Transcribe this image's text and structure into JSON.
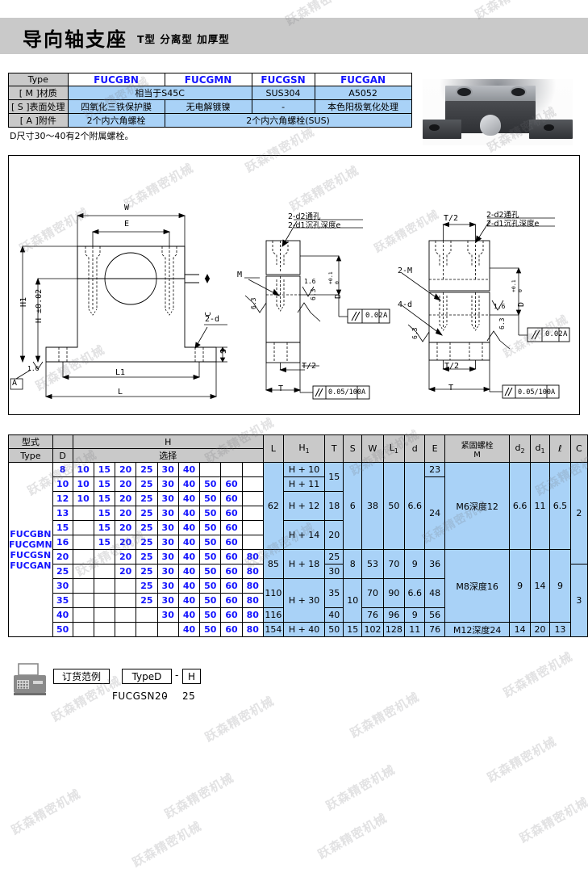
{
  "header": {
    "title": "导向轴支座",
    "subtitle": "T型  分离型  加厚型"
  },
  "spec_table": {
    "rows": [
      {
        "label": "Type",
        "cells": [
          {
            "t": "FUCGBN",
            "span": 1,
            "style": "type"
          },
          {
            "t": "FUCGMN",
            "span": 1,
            "style": "type"
          },
          {
            "t": "FUCGSN",
            "span": 1,
            "style": "type"
          },
          {
            "t": "FUCGAN",
            "span": 1,
            "style": "type"
          }
        ]
      },
      {
        "label": "[ M ]材质",
        "cells": [
          {
            "t": "相当于S45C",
            "span": 2,
            "style": "cell"
          },
          {
            "t": "SUS304",
            "span": 1,
            "style": "cell"
          },
          {
            "t": "A5052",
            "span": 1,
            "style": "cell"
          }
        ]
      },
      {
        "label": "[ S ]表面处理",
        "cells": [
          {
            "t": "四氧化三铁保护膜",
            "span": 1,
            "style": "cell"
          },
          {
            "t": "无电解镀镍",
            "span": 1,
            "style": "cell"
          },
          {
            "t": "-",
            "span": 1,
            "style": "cell"
          },
          {
            "t": "本色阳极氧化处理",
            "span": 1,
            "style": "cell"
          }
        ]
      },
      {
        "label": "[ A ]附件",
        "cells": [
          {
            "t": "2个内六角螺栓",
            "span": 1,
            "style": "cell"
          },
          {
            "t": "2个内六角螺栓(SUS)",
            "span": 3,
            "style": "cell"
          }
        ]
      }
    ],
    "note": "D尺寸30～40有2个附属螺栓。"
  },
  "drawings": {
    "front": {
      "labels": [
        "W",
        "E",
        "H1",
        "H ±0.02",
        "C",
        "2-d",
        "S",
        "L1",
        "L",
        "1.6",
        "A"
      ]
    },
    "side_small": {
      "labels": [
        "2-d2通孔",
        "2-d1沉孔深度e",
        "M",
        "1.6",
        "6.3",
        "T/2",
        "T",
        "// 0.02 A",
        "// 0.05/100 A"
      ]
    },
    "side_large": {
      "labels": [
        "2-d2通孔",
        "2-d1沉孔深度e",
        "2-M",
        "4-d",
        "1.6",
        "6.3",
        "T/2",
        "T",
        "// 0.02 A",
        "// 0.05/100 A"
      ]
    },
    "tolerance_02": "0.02",
    "tolerance_05": "0.05/100",
    "datum": "A",
    "dia_label": "D",
    "dia_tol_upper": "+0.1",
    "dia_tol_lower": "0"
  },
  "dim_table": {
    "headers": {
      "type_cn": "型式",
      "type_en": "Type",
      "d": "D",
      "h": "H",
      "h_sel": "选择",
      "l": "L",
      "h1": "H",
      "h1_sub": "1",
      "t": "T",
      "s": "S",
      "w": "W",
      "l1": "L",
      "l1_sub": "1",
      "d_small": "d",
      "e": "E",
      "bolt_cn": "紧固螺栓",
      "bolt_m": "M",
      "d2": "d",
      "d2_sub": "2",
      "d1": "d",
      "d1_sub": "1",
      "l_len": "ℓ",
      "c": "C"
    },
    "types": [
      "FUCGBN",
      "FUCGMN",
      "FUCGSN",
      "FUCGAN"
    ],
    "h_columns": [
      "10",
      "15",
      "20",
      "25",
      "30",
      "40",
      "50",
      "60",
      "80"
    ],
    "rows": [
      {
        "d": "8",
        "h_sel": [
          "10",
          "15",
          "20",
          "25",
          "30",
          "40",
          "",
          "",
          ""
        ]
      },
      {
        "d": "10",
        "h_sel": [
          "10",
          "15",
          "20",
          "25",
          "30",
          "40",
          "50",
          "60",
          ""
        ]
      },
      {
        "d": "12",
        "h_sel": [
          "10",
          "15",
          "20",
          "25",
          "30",
          "40",
          "50",
          "60",
          ""
        ]
      },
      {
        "d": "13",
        "h_sel": [
          "",
          "15",
          "20",
          "25",
          "30",
          "40",
          "50",
          "60",
          ""
        ]
      },
      {
        "d": "15",
        "h_sel": [
          "",
          "15",
          "20",
          "25",
          "30",
          "40",
          "50",
          "60",
          ""
        ]
      },
      {
        "d": "16",
        "h_sel": [
          "",
          "15",
          "20",
          "25",
          "30",
          "40",
          "50",
          "60",
          ""
        ]
      },
      {
        "d": "20",
        "h_sel": [
          "",
          "",
          "20",
          "25",
          "30",
          "40",
          "50",
          "60",
          "80"
        ]
      },
      {
        "d": "25",
        "h_sel": [
          "",
          "",
          "20",
          "25",
          "30",
          "40",
          "50",
          "60",
          "80"
        ]
      },
      {
        "d": "30",
        "h_sel": [
          "",
          "",
          "",
          "25",
          "30",
          "40",
          "50",
          "60",
          "80"
        ]
      },
      {
        "d": "35",
        "h_sel": [
          "",
          "",
          "",
          "25",
          "30",
          "40",
          "50",
          "60",
          "80"
        ]
      },
      {
        "d": "40",
        "h_sel": [
          "",
          "",
          "",
          "",
          "30",
          "40",
          "50",
          "60",
          "80"
        ]
      },
      {
        "d": "50",
        "h_sel": [
          "",
          "",
          "",
          "",
          "",
          "40",
          "50",
          "60",
          "80"
        ]
      }
    ],
    "L": [
      {
        "v": "62",
        "span": 6
      },
      {
        "v": "85",
        "span": 2
      },
      {
        "v": "110",
        "span": 2
      },
      {
        "v": "116",
        "span": 1
      },
      {
        "v": "154",
        "span": 1
      }
    ],
    "H1": [
      {
        "v": "H + 10",
        "span": 1
      },
      {
        "v": "H + 11",
        "span": 1
      },
      {
        "v": "H + 12",
        "span": 2
      },
      {
        "v": "H + 14",
        "span": 2
      },
      {
        "v": "H + 18",
        "span": 2
      },
      {
        "v": "H + 30",
        "span": 3
      },
      {
        "v": "H + 40",
        "span": 1
      }
    ],
    "T": [
      {
        "v": "15",
        "span": 2
      },
      {
        "v": "18",
        "span": 2
      },
      {
        "v": "20",
        "span": 2
      },
      {
        "v": "25",
        "span": 1
      },
      {
        "v": "30",
        "span": 1
      },
      {
        "v": "35",
        "span": 2
      },
      {
        "v": "40",
        "span": 1
      },
      {
        "v": "50",
        "span": 1
      }
    ],
    "S": [
      {
        "v": "6",
        "span": 6
      },
      {
        "v": "8",
        "span": 2
      },
      {
        "v": "10",
        "span": 3
      },
      {
        "v": "15",
        "span": 1
      }
    ],
    "W": [
      {
        "v": "38",
        "span": 6
      },
      {
        "v": "53",
        "span": 2
      },
      {
        "v": "70",
        "span": 2
      },
      {
        "v": "76",
        "span": 1
      },
      {
        "v": "102",
        "span": 1
      }
    ],
    "L1": [
      {
        "v": "50",
        "span": 6
      },
      {
        "v": "70",
        "span": 2
      },
      {
        "v": "90",
        "span": 2
      },
      {
        "v": "96",
        "span": 1
      },
      {
        "v": "128",
        "span": 1
      }
    ],
    "d": [
      {
        "v": "6.6",
        "span": 6
      },
      {
        "v": "9",
        "span": 2
      },
      {
        "v": "6.6",
        "span": 2
      },
      {
        "v": "9",
        "span": 1
      },
      {
        "v": "11",
        "span": 1
      }
    ],
    "E": [
      {
        "v": "23",
        "span": 1
      },
      {
        "v": "24",
        "span": 5
      },
      {
        "v": "36",
        "span": 2
      },
      {
        "v": "48",
        "span": 2
      },
      {
        "v": "56",
        "span": 1
      },
      {
        "v": "76",
        "span": 1
      }
    ],
    "bolt": [
      {
        "v": "M6深度12",
        "span": 6
      },
      {
        "v": "M8深度16",
        "span": 5
      },
      {
        "v": "M12深度24",
        "span": 1
      }
    ],
    "d2": [
      {
        "v": "6.6",
        "span": 6
      },
      {
        "v": "9",
        "span": 5
      },
      {
        "v": "14",
        "span": 1
      }
    ],
    "d1": [
      {
        "v": "11",
        "span": 6
      },
      {
        "v": "14",
        "span": 5
      },
      {
        "v": "20",
        "span": 1
      }
    ],
    "ell": [
      {
        "v": "6.5",
        "span": 6
      },
      {
        "v": "9",
        "span": 5
      },
      {
        "v": "13",
        "span": 1
      }
    ],
    "C": [
      {
        "v": "2",
        "span": 7
      },
      {
        "v": "3",
        "span": 5
      }
    ]
  },
  "order_example": {
    "icon": "fax-icon",
    "label": "订货范例",
    "type_box": "TypeD",
    "dash": "-",
    "h_box": "H",
    "code_type": "FUCGSN20",
    "code_dash": "-",
    "code_h": "25"
  },
  "watermark": {
    "text": "跃森精密机械"
  },
  "colors": {
    "header_gray": "#c9c9c9",
    "table_blue": "#a9d2f7",
    "type_blue": "#1414ff",
    "border": "#000000"
  }
}
